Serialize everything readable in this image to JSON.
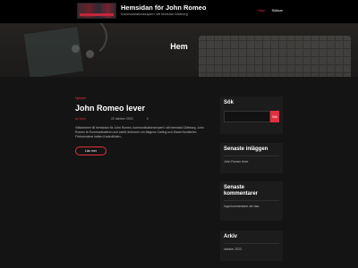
{
  "site": {
    "title": "Hemsidan för John Romeo",
    "tagline": "Kommunikationsexpert i sitt hemstad Göteborg"
  },
  "nav": {
    "items": [
      "Hem",
      "Sökkar"
    ]
  },
  "hero": {
    "title": "Hem"
  },
  "post": {
    "category": "Nyheter",
    "title": "John Romeo lever",
    "author": "av John",
    "date": "22 oktober 2023",
    "comments": "0",
    "excerpt": "Välkommen till hemsidan för John Romeo, kommunikationsexpert i sitt hemstad Göteborg. John Romeo är Kommunikatören och varför drömmer om Magnus Carling och Diana Nordström. Förtroendens hatten Kontrollöden...",
    "more_label": "Läs mer"
  },
  "sidebar": {
    "search": {
      "title": "Sök",
      "placeholder": "",
      "button_label": "Sök"
    },
    "recent_posts": {
      "title": "Senaste inläggen",
      "items": [
        "John Romeo lever"
      ]
    },
    "recent_comments": {
      "title": "Senaste kommentarer",
      "text": "Inga kommentarer att visa."
    },
    "archive": {
      "title": "Arkiv",
      "items": [
        "oktober 2023"
      ]
    }
  },
  "colors": {
    "accent": "#e0303f",
    "background": "#141414",
    "header": "#000000"
  }
}
